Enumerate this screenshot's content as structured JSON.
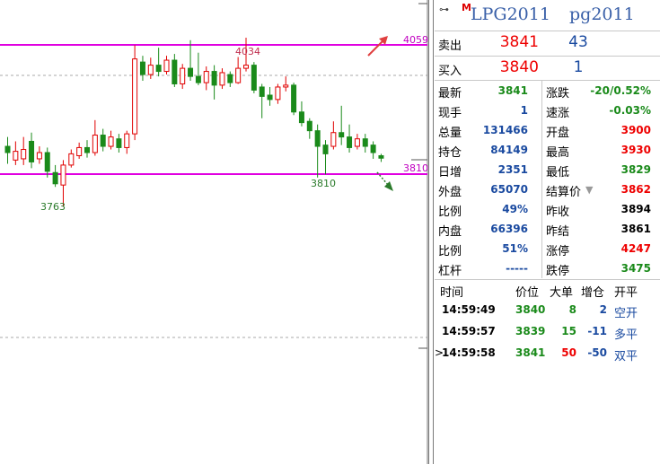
{
  "colors": {
    "up": "#e00000",
    "down": "#1a8a1a",
    "level": "#e000e0",
    "trend_up": "#e04040",
    "trend_down": "#2a7a2a"
  },
  "chart": {
    "levels": {
      "top": "4059",
      "bottom": "3810"
    },
    "labels": {
      "high": "4034",
      "low1": "3763",
      "low2": "3810"
    },
    "candles": [
      {
        "o": 3860,
        "c": 3850,
        "h": 3875,
        "l": 3832
      },
      {
        "o": 3838,
        "c": 3852,
        "h": 3868,
        "l": 3830
      },
      {
        "o": 3840,
        "c": 3855,
        "h": 3875,
        "l": 3830
      },
      {
        "o": 3868,
        "c": 3835,
        "h": 3882,
        "l": 3825
      },
      {
        "o": 3840,
        "c": 3850,
        "h": 3860,
        "l": 3832
      },
      {
        "o": 3850,
        "c": 3820,
        "h": 3858,
        "l": 3810
      },
      {
        "o": 3818,
        "c": 3800,
        "h": 3830,
        "l": 3795
      },
      {
        "o": 3798,
        "c": 3830,
        "h": 3838,
        "l": 3763
      },
      {
        "o": 3830,
        "c": 3848,
        "h": 3855,
        "l": 3826
      },
      {
        "o": 3845,
        "c": 3858,
        "h": 3866,
        "l": 3840
      },
      {
        "o": 3858,
        "c": 3850,
        "h": 3870,
        "l": 3842
      },
      {
        "o": 3850,
        "c": 3878,
        "h": 3902,
        "l": 3845
      },
      {
        "o": 3878,
        "c": 3860,
        "h": 3888,
        "l": 3852
      },
      {
        "o": 3860,
        "c": 3875,
        "h": 3885,
        "l": 3855
      },
      {
        "o": 3872,
        "c": 3858,
        "h": 3880,
        "l": 3850
      },
      {
        "o": 3858,
        "c": 3880,
        "h": 3885,
        "l": 3848
      },
      {
        "o": 3880,
        "c": 4000,
        "h": 4022,
        "l": 3870
      },
      {
        "o": 3995,
        "c": 3975,
        "h": 4005,
        "l": 3965
      },
      {
        "o": 3975,
        "c": 3990,
        "h": 4002,
        "l": 3968
      },
      {
        "o": 3990,
        "c": 3980,
        "h": 4018,
        "l": 3972
      },
      {
        "o": 3980,
        "c": 3998,
        "h": 4005,
        "l": 3975
      },
      {
        "o": 3998,
        "c": 3960,
        "h": 4008,
        "l": 3955
      },
      {
        "o": 3960,
        "c": 3985,
        "h": 3992,
        "l": 3952
      },
      {
        "o": 3985,
        "c": 3972,
        "h": 4030,
        "l": 3965
      },
      {
        "o": 3972,
        "c": 3962,
        "h": 4010,
        "l": 3958
      },
      {
        "o": 3962,
        "c": 3980,
        "h": 3988,
        "l": 3950
      },
      {
        "o": 3980,
        "c": 3958,
        "h": 3990,
        "l": 3935
      },
      {
        "o": 3958,
        "c": 3978,
        "h": 3985,
        "l": 3952
      },
      {
        "o": 3975,
        "c": 3962,
        "h": 3980,
        "l": 3955
      },
      {
        "o": 3962,
        "c": 3985,
        "h": 4003,
        "l": 3960
      },
      {
        "o": 3985,
        "c": 3990,
        "h": 4034,
        "l": 3980
      },
      {
        "o": 3990,
        "c": 3950,
        "h": 3995,
        "l": 3945
      },
      {
        "o": 3955,
        "c": 3940,
        "h": 3960,
        "l": 3905
      },
      {
        "o": 3942,
        "c": 3935,
        "h": 3955,
        "l": 3925
      },
      {
        "o": 3935,
        "c": 3955,
        "h": 3960,
        "l": 3928
      },
      {
        "o": 3955,
        "c": 3958,
        "h": 3972,
        "l": 3948
      },
      {
        "o": 3958,
        "c": 3915,
        "h": 3962,
        "l": 3910
      },
      {
        "o": 3915,
        "c": 3898,
        "h": 3932,
        "l": 3892
      },
      {
        "o": 3900,
        "c": 3885,
        "h": 3905,
        "l": 3872
      },
      {
        "o": 3885,
        "c": 3860,
        "h": 3895,
        "l": 3810
      },
      {
        "o": 3862,
        "c": 3848,
        "h": 3870,
        "l": 3815
      },
      {
        "o": 3860,
        "c": 3882,
        "h": 3900,
        "l": 3855
      },
      {
        "o": 3882,
        "c": 3875,
        "h": 3925,
        "l": 3862
      },
      {
        "o": 3875,
        "c": 3858,
        "h": 3895,
        "l": 3850
      },
      {
        "o": 3860,
        "c": 3872,
        "h": 3880,
        "l": 3855
      },
      {
        "o": 3872,
        "c": 3860,
        "h": 3880,
        "l": 3850
      },
      {
        "o": 3862,
        "c": 3850,
        "h": 3868,
        "l": 3840
      },
      {
        "o": 3845,
        "c": 3841,
        "h": 3848,
        "l": 3835
      }
    ]
  },
  "header": {
    "link_icon": "link-icon",
    "market_flag": "M",
    "symbol": "LPG2011",
    "symbol_alt": "pg2011"
  },
  "orderbook": [
    {
      "label": "卖出",
      "price": "3841",
      "volume": "43"
    },
    {
      "label": "买入",
      "price": "3840",
      "volume": "1"
    }
  ],
  "quote": [
    {
      "l1": "最新",
      "v1": "3841",
      "c1": "green",
      "l2": "涨跌",
      "v2": "-20/0.52%",
      "c2": "green"
    },
    {
      "l1": "现手",
      "v1": "1",
      "c1": "blue",
      "l2": "速涨",
      "v2": "-0.03%",
      "c2": "green"
    },
    {
      "l1": "总量",
      "v1": "131466",
      "c1": "blue",
      "l2": "开盘",
      "v2": "3900",
      "c2": "red"
    },
    {
      "l1": "持仓",
      "v1": "84149",
      "c1": "blue",
      "l2": "最高",
      "v2": "3930",
      "c2": "red"
    },
    {
      "l1": "日增",
      "v1": "2351",
      "c1": "blue",
      "l2": "最低",
      "v2": "3829",
      "c2": "green"
    },
    {
      "l1": "外盘",
      "v1": "65070",
      "c1": "blue",
      "l2": "结算价",
      "v2": "3862",
      "c2": "red"
    },
    {
      "l1": "比例",
      "v1": "49%",
      "c1": "blue",
      "l2": "昨收",
      "v2": "3894",
      "c2": "black"
    },
    {
      "l1": "内盘",
      "v1": "66396",
      "c1": "blue",
      "l2": "昨结",
      "v2": "3861",
      "c2": "black"
    },
    {
      "l1": "比例",
      "v1": "51%",
      "c1": "blue",
      "l2": "涨停",
      "v2": "4247",
      "c2": "red"
    },
    {
      "l1": "杠杆",
      "v1": "-----",
      "c1": "blue",
      "l2": "跌停",
      "v2": "3475",
      "c2": "green"
    }
  ],
  "ticks": {
    "headers": {
      "time": "时间",
      "price": "价位",
      "big": "大单",
      "oi": "增仓",
      "type": "开平"
    },
    "rows": [
      {
        "marker": "",
        "time": "14:59:49",
        "price": "3840",
        "big": "8",
        "oi": "2",
        "type": "空开",
        "pc": "green",
        "bc": "green",
        "oc": "blue"
      },
      {
        "marker": "",
        "time": "14:59:57",
        "price": "3839",
        "big": "15",
        "oi": "-11",
        "type": "多平",
        "pc": "green",
        "bc": "green",
        "oc": "blue"
      },
      {
        "marker": ">",
        "time": "14:59:58",
        "price": "3841",
        "big": "50",
        "oi": "-50",
        "type": "双平",
        "pc": "green",
        "bc": "red",
        "oc": "blue"
      }
    ]
  }
}
